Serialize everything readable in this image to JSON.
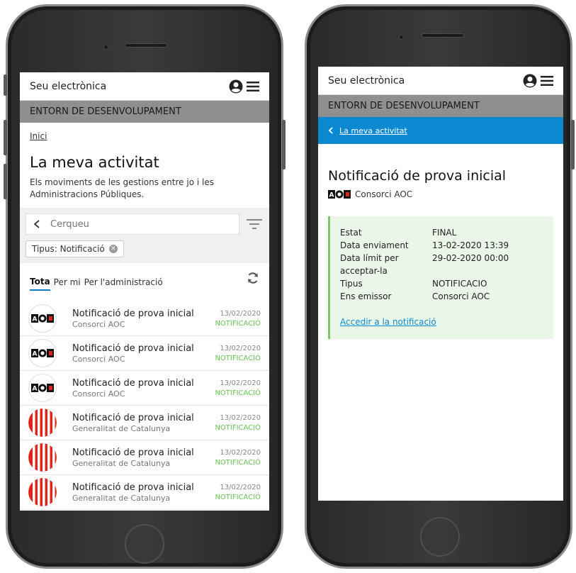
{
  "left": {
    "header": {
      "site_title": "Seu electrònica"
    },
    "env_label": "ENTORN DE DESENVOLUPAMENT",
    "breadcrumb": "Inici",
    "page_title": "La meva activitat",
    "page_desc": "Els moviments de les gestions entre jo i les Administracions Públiques.",
    "search": {
      "placeholder": "Cerqueu"
    },
    "chip_label": "Tipus: Notificació",
    "tabs": [
      {
        "label": "Tota"
      },
      {
        "label": "Per mi"
      },
      {
        "label": "Per l'administració"
      }
    ],
    "items": [
      {
        "logo": "aoc",
        "title": "Notificació de prova inicial",
        "org": "Consorci AOC",
        "date": "13/02/2020",
        "type": "NOTIFICACIÓ"
      },
      {
        "logo": "aoc",
        "title": "Notificació de prova inicial",
        "org": "Consorci AOC",
        "date": "13/02/2020",
        "type": "NOTIFICACIÓ"
      },
      {
        "logo": "aoc",
        "title": "Notificació de prova inicial",
        "org": "Consorci AOC",
        "date": "13/02/2020",
        "type": "NOTIFICACIÓ"
      },
      {
        "logo": "gencat",
        "title": "Notificació de prova inicial",
        "org": "Generalitat de Catalunya",
        "date": "13/02/2020",
        "type": "NOTIFICACIÓ"
      },
      {
        "logo": "gencat",
        "title": "Notificació de prova inicial",
        "org": "Generalitat de Catalunya",
        "date": "13/02/2020",
        "type": "NOTIFICACIÓ"
      },
      {
        "logo": "gencat",
        "title": "Notificació de prova inicial",
        "org": "Generalitat de Catalunya",
        "date": "13/02/2020",
        "type": "NOTIFICACIÓ"
      }
    ]
  },
  "right": {
    "header": {
      "site_title": "Seu electrònica"
    },
    "env_label": "ENTORN DE DESENVOLUPAMENT",
    "back_link": "La meva activitat",
    "detail_title": "Notificació de prova inicial",
    "org": "Consorci AOC",
    "fields": [
      {
        "key": "Estat",
        "value": "FINAL"
      },
      {
        "key": "Data enviament",
        "value": "13-02-2020 13:39"
      },
      {
        "key": "Data límit per acceptar-la",
        "value": "29-02-2020 00:00"
      },
      {
        "key": "Tipus",
        "value": "NOTIFICACIO"
      },
      {
        "key": "Ens emissor",
        "value": "Consorci AOC"
      }
    ],
    "action_link": "Accedir a la notificació"
  },
  "colors": {
    "env_bar": "#8f8f8f",
    "accent_blue": "#0a89d1",
    "status_green": "#6bbf59",
    "card_bg": "#eaf6e8"
  }
}
